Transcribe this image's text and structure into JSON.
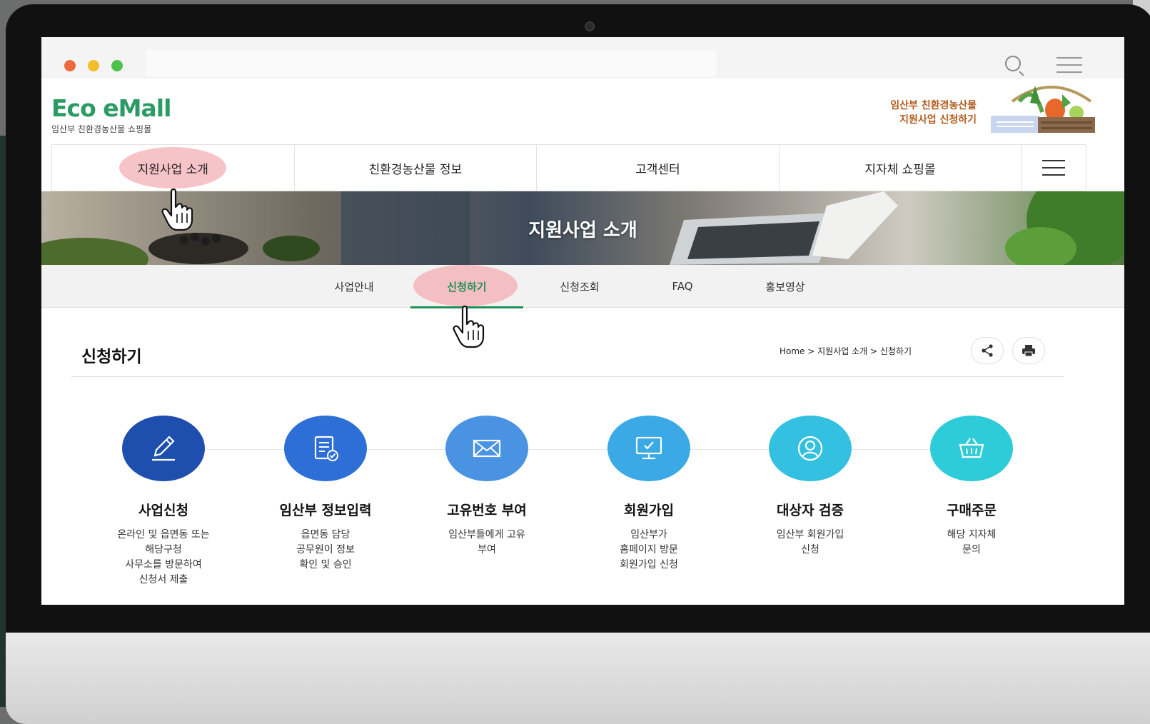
{
  "site": {
    "logo_main": "Eco eMall",
    "logo_sub": "임산부 친환경농산물 쇼핑몰",
    "promo_line1": "임산부 친환경농산물",
    "promo_line2": "지원사업 신청하기"
  },
  "gnb": {
    "items": [
      {
        "label": "지원사업 소개"
      },
      {
        "label": "친환경농산물 정보"
      },
      {
        "label": "고객센터"
      },
      {
        "label": "지자체 쇼핑몰"
      }
    ],
    "menu_icon": "hamburger-menu-icon"
  },
  "banner": {
    "title": "지원사업 소개"
  },
  "subnav": {
    "items": [
      {
        "label": "사업안내"
      },
      {
        "label": "신청하기"
      },
      {
        "label": "신청조회"
      },
      {
        "label": "FAQ"
      },
      {
        "label": "홍보영상"
      }
    ],
    "active": "신청하기"
  },
  "page": {
    "title": "신청하기",
    "breadcrumb": "Home > 지원사업 소개 > 신청하기",
    "share_icon": "share-icon",
    "print_icon": "print-icon"
  },
  "steps": [
    {
      "title": "사업신청",
      "desc": "온라인 및 읍면동 또는\n해당구청\n사무소를 방문하여\n신청서 제출",
      "color": "#1f4fae",
      "icon": "pencil-icon"
    },
    {
      "title": "임산부 정보입력",
      "desc": "읍면동 담당\n공무원이 정보\n확인 및 승인",
      "color": "#2d6fd6",
      "icon": "document-check-icon"
    },
    {
      "title": "고유번호 부여",
      "desc": "임산부들에게 고유\n부여",
      "color": "#4a93e3",
      "icon": "envelope-icon"
    },
    {
      "title": "회원가입",
      "desc": "임산부가\n홈페이지 방문\n회원가입 신청",
      "color": "#3aa9e6",
      "icon": "monitor-check-icon"
    },
    {
      "title": "대상자 검증",
      "desc": "임산부 회원가입\n신청",
      "color": "#34c0e0",
      "icon": "user-icon"
    },
    {
      "title": "구매주문",
      "desc": "해당 지자체\n문의",
      "color": "#2ecbd8",
      "icon": "basket-icon"
    }
  ],
  "colors": {
    "brand_green": "#2b9a63",
    "highlight_pink": "#f4b9bd",
    "promo_orange": "#b45a1a"
  }
}
